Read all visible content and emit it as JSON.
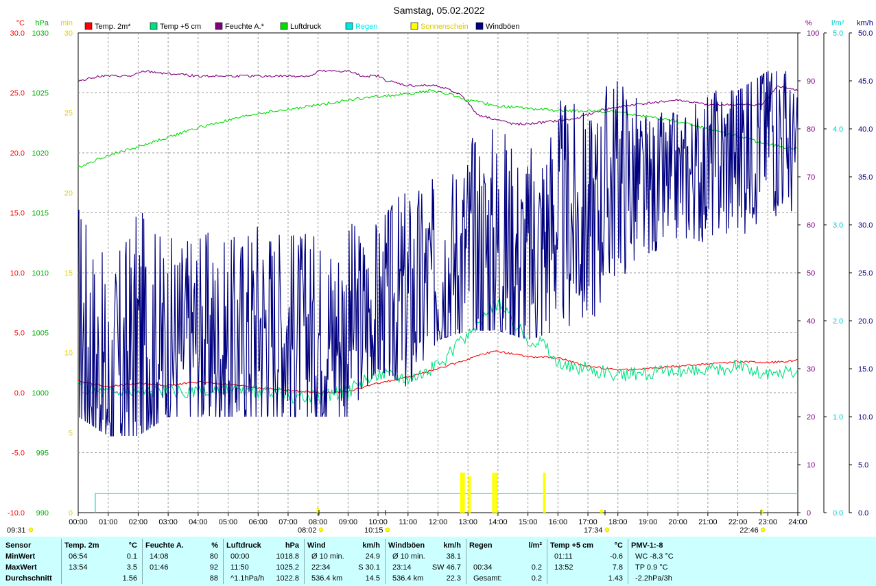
{
  "colors": {
    "temp2m": "#ff0000",
    "temp5cm": "#00e080",
    "humidity": "#800080",
    "pressure": "#00dd00",
    "rain": "#00e5e5",
    "sunshine": "#ffff00",
    "gusts": "#000080",
    "panel_bg": "#ccffff"
  },
  "chart_data": {
    "type": "line",
    "title": "Samstag, 05.02.2022",
    "x_tick_labels": [
      "00:00",
      "01:00",
      "02:00",
      "03:00",
      "04:00",
      "05:00",
      "06:00",
      "07:00",
      "08:00",
      "09:00",
      "10:00",
      "11:00",
      "12:00",
      "13:00",
      "14:00",
      "15:00",
      "16:00",
      "17:00",
      "18:00",
      "19:00",
      "20:00",
      "21:00",
      "22:00",
      "23:00",
      "24:00"
    ],
    "axes": {
      "temp_c": {
        "unit": "°C",
        "range": [
          -10,
          30
        ],
        "ticks": [
          "30.0",
          "25.0",
          "20.0",
          "15.0",
          "10.0",
          "5.0",
          "0.0",
          "-5.0",
          "-10.0"
        ]
      },
      "pressure_hpa": {
        "unit": "hPa",
        "range": [
          990,
          1030
        ],
        "ticks": [
          "1030",
          "1025",
          "1020",
          "1015",
          "1010",
          "1005",
          "1000",
          "995",
          "990"
        ]
      },
      "sun_min": {
        "unit": "min",
        "range": [
          0,
          30
        ],
        "ticks": [
          "30",
          "25",
          "20",
          "15",
          "10",
          "5",
          "0"
        ]
      },
      "humidity_pct": {
        "unit": "%",
        "range": [
          0,
          100
        ],
        "ticks": [
          "100",
          "90",
          "80",
          "70",
          "60",
          "50",
          "40",
          "30",
          "20",
          "10",
          "0"
        ]
      },
      "rain_lm2": {
        "unit": "l/m²",
        "range": [
          0,
          5
        ],
        "ticks": [
          "5.0",
          "4.0",
          "3.0",
          "2.0",
          "1.0",
          "0.0"
        ]
      },
      "wind_kmh": {
        "unit": "km/h",
        "range": [
          0,
          50
        ],
        "ticks": [
          "50.0",
          "45.0",
          "40.0",
          "35.0",
          "30.0",
          "25.0",
          "20.0",
          "15.0",
          "10.0",
          "5.0",
          "0.0"
        ]
      }
    },
    "legend": [
      "Temp. 2m*",
      "Temp +5 cm",
      "Feuchte A.*",
      "Luftdruck",
      "Regen",
      "Sonnenschein",
      "Windböen"
    ],
    "grid": true,
    "series": [
      {
        "name": "Temp. 2m*",
        "axis": "temp_c",
        "x": [
          0,
          1,
          2,
          3,
          4,
          5,
          6,
          7,
          8,
          9,
          10,
          11,
          12,
          13,
          13.9,
          15,
          16,
          17,
          18,
          19,
          20,
          21,
          22,
          23,
          24
        ],
        "y": [
          1.0,
          0.5,
          0.8,
          0.6,
          0.9,
          0.7,
          0.4,
          0.2,
          0.0,
          0.1,
          0.8,
          1.3,
          2.0,
          2.8,
          3.5,
          3.0,
          2.9,
          2.2,
          1.9,
          2.0,
          2.2,
          2.4,
          2.6,
          2.5,
          2.7
        ]
      },
      {
        "name": "Temp +5 cm",
        "axis": "temp_c",
        "x": [
          0,
          1,
          2,
          3,
          4,
          5,
          6,
          7,
          7.5,
          8,
          9,
          10,
          11,
          12,
          13,
          14,
          15,
          15.5,
          16,
          17,
          18,
          19,
          20,
          21,
          22,
          23,
          24
        ],
        "y": [
          0.5,
          0.1,
          0.2,
          0.1,
          0.0,
          0.1,
          0.0,
          -0.2,
          -0.4,
          -0.3,
          0.1,
          1.7,
          1.3,
          2.2,
          4.8,
          7.5,
          4.5,
          4.3,
          2.3,
          2.0,
          1.4,
          1.7,
          1.8,
          1.8,
          2.2,
          1.5,
          1.8
        ]
      },
      {
        "name": "Feuchte A.*",
        "axis": "humidity_pct",
        "x": [
          0,
          0.7,
          1.8,
          2.2,
          4,
          6,
          7,
          7.8,
          8,
          9,
          9.5,
          10,
          10.3,
          11,
          12,
          12.8,
          13.3,
          14.5,
          15,
          16.5,
          17.5,
          18.5,
          20,
          21,
          22,
          22.8,
          23.1,
          23.3,
          24
        ],
        "y": [
          90,
          91,
          91,
          92,
          91,
          91,
          91,
          91,
          92,
          92,
          91,
          91,
          90,
          89,
          89,
          87,
          83,
          81,
          81,
          82,
          84,
          85,
          86,
          85,
          85,
          85,
          87,
          89,
          88
        ]
      },
      {
        "name": "Luftdruck",
        "axis": "pressure_hpa",
        "x": [
          0,
          1,
          2,
          3,
          4,
          5,
          6,
          7,
          8,
          9,
          10,
          11,
          11.8,
          12.5,
          13,
          14,
          15,
          16,
          17,
          18,
          19,
          20,
          21,
          22,
          23,
          24
        ],
        "y": [
          1018.8,
          1019.8,
          1020.5,
          1021.3,
          1022.1,
          1022.7,
          1023.3,
          1023.6,
          1024.0,
          1024.4,
          1024.7,
          1024.9,
          1025.2,
          1024.8,
          1024.4,
          1023.9,
          1023.7,
          1023.5,
          1023.5,
          1023.4,
          1023.0,
          1022.6,
          1022.0,
          1021.4,
          1020.7,
          1020.3
        ]
      },
      {
        "name": "Regen",
        "axis": "rain_lm2",
        "x": [
          0.57,
          24
        ],
        "y": [
          0.2,
          0.2
        ]
      },
      {
        "name": "Sonnenschein",
        "axis": "sun_min",
        "x": [
          8.0,
          12.78,
          12.85,
          13.05,
          13.85,
          13.95,
          15.55,
          17.45,
          22.8
        ],
        "y": [
          0.3,
          2.5,
          2.5,
          2.3,
          2.5,
          2.5,
          2.5,
          0.2,
          0.2
        ]
      },
      {
        "name": "Windböen",
        "axis": "wind_kmh",
        "x": [
          0,
          1,
          2,
          3,
          4,
          5,
          6,
          7,
          8,
          9,
          10,
          11,
          12,
          13,
          14,
          15,
          16,
          17,
          18,
          19,
          20,
          21,
          22,
          23,
          24
        ],
        "y": [
          20,
          12,
          18,
          17,
          19,
          17,
          20,
          19,
          19,
          19,
          21,
          22,
          25,
          27,
          28,
          26,
          31,
          30,
          36,
          33,
          35,
          36,
          38,
          42,
          37
        ],
        "range_band": [
          [
            10,
            38
          ],
          [
            8,
            35
          ],
          [
            8,
            36
          ],
          [
            10,
            34
          ],
          [
            10,
            32
          ],
          [
            10,
            33
          ],
          [
            10,
            34
          ],
          [
            10,
            32
          ],
          [
            10,
            31
          ],
          [
            10,
            33
          ],
          [
            15,
            35
          ],
          [
            13,
            38
          ],
          [
            18,
            38
          ],
          [
            19,
            45
          ],
          [
            19,
            46
          ],
          [
            18,
            42
          ],
          [
            19,
            44
          ],
          [
            20,
            44
          ],
          [
            22,
            45
          ],
          [
            27,
            44
          ],
          [
            28,
            42
          ],
          [
            28,
            44
          ],
          [
            24,
            44
          ],
          [
            24,
            46
          ],
          [
            33,
            46
          ]
        ]
      }
    ],
    "time_markers": [
      {
        "x": 0,
        "label": "09:31"
      },
      {
        "x": 8.03,
        "label": "08:02"
      },
      {
        "x": 10.25,
        "label": "10:15"
      },
      {
        "x": 17.57,
        "label": "17:34"
      },
      {
        "x": 22.77,
        "label": "22:46"
      }
    ]
  },
  "table": {
    "columns": [
      {
        "header": "Sensor",
        "unit": "",
        "rows": [
          "MinWert",
          "MaxWert",
          "Durchschnitt"
        ]
      },
      {
        "header": "Temp. 2m",
        "unit": "°C",
        "times": [
          "06:54",
          "13:54",
          ""
        ],
        "values": [
          "0.1",
          "3.5",
          "1.56"
        ]
      },
      {
        "header": "Feuchte A.",
        "unit": "%",
        "times": [
          "14:08",
          "01:46",
          ""
        ],
        "values": [
          "80",
          "92",
          "88"
        ]
      },
      {
        "header": "Luftdruck",
        "unit": "hPa",
        "times": [
          "00:00",
          "11:50",
          "^1.1hPa/h"
        ],
        "values": [
          "1018.8",
          "1025.2",
          "1022.8"
        ]
      },
      {
        "header": "Wind",
        "unit": "km/h",
        "times": [
          "Ø 10 min.",
          "22:34",
          "536.4 km"
        ],
        "values": [
          "24.9",
          "S 30.1",
          "14.5"
        ]
      },
      {
        "header": "Windböen",
        "unit": "km/h",
        "times": [
          "Ø 10 min.",
          "23:14",
          "536.4 km"
        ],
        "values": [
          "38.1",
          "SW 46.7",
          "22.3"
        ]
      },
      {
        "header": "Regen",
        "unit": "l/m²",
        "times": [
          "",
          "00:34",
          "Gesamt:"
        ],
        "values": [
          "",
          "0.2",
          "0.2"
        ]
      },
      {
        "header": "Temp +5 cm",
        "unit": "°C",
        "times": [
          "01:11",
          "13:52",
          ""
        ],
        "values": [
          "-0.6",
          "7.8",
          "1.43"
        ]
      },
      {
        "header": "PMV-1:-8",
        "unit": "",
        "times": [
          "WC -8.3 °C",
          "TP 0.9 °C",
          "-2.2hPa/3h"
        ],
        "values": [
          "",
          "",
          ""
        ]
      }
    ]
  }
}
